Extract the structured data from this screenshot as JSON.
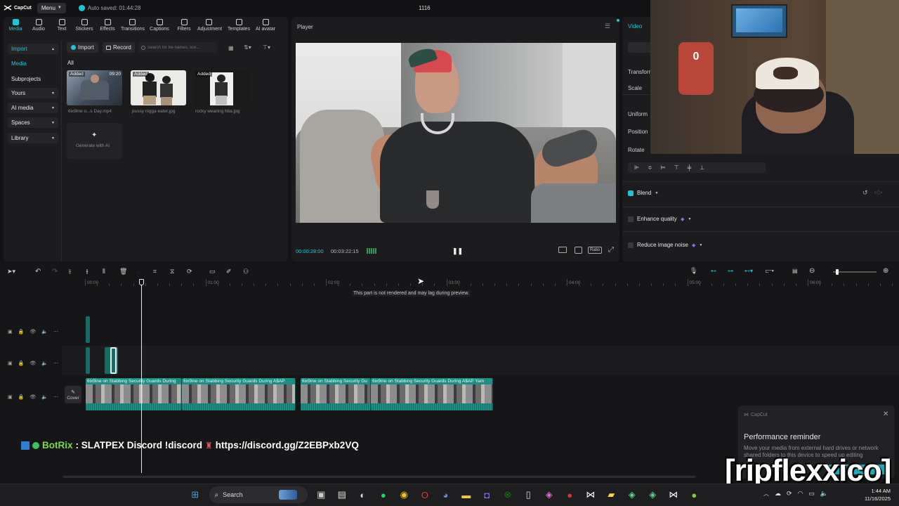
{
  "titlebar": {
    "logo": "CapCut",
    "menu": "Menu",
    "autosave": "Auto saved: 01:44:28",
    "project": "1116"
  },
  "toolbar": [
    {
      "label": "Media",
      "icon": "media-icon",
      "active": true
    },
    {
      "label": "Audio",
      "icon": "audio-icon"
    },
    {
      "label": "Text",
      "icon": "text-icon"
    },
    {
      "label": "Stickers",
      "icon": "stickers-icon"
    },
    {
      "label": "Effects",
      "icon": "effects-icon"
    },
    {
      "label": "Transitions",
      "icon": "transitions-icon"
    },
    {
      "label": "Captions",
      "icon": "captions-icon"
    },
    {
      "label": "Filters",
      "icon": "filters-icon"
    },
    {
      "label": "Adjustment",
      "icon": "adjustment-icon"
    },
    {
      "label": "Templates",
      "icon": "templates-icon"
    },
    {
      "label": "AI avatar",
      "icon": "ai-avatar-icon"
    }
  ],
  "sidebar": {
    "items": [
      "Import",
      "Media",
      "Subprojects",
      "Yours",
      "AI media",
      "Spaces",
      "Library"
    ]
  },
  "media": {
    "import_label": "Import",
    "record_label": "Record",
    "search_placeholder": "Search for file names, sce...",
    "filter_all": "All",
    "items": [
      {
        "name": "6ix9ine o...s Day.mp4",
        "badge": "Added",
        "duration": "09:20"
      },
      {
        "name": "pussy nigga eater.jpg",
        "badge": "Added"
      },
      {
        "name": "rocky wearing hba.jpg",
        "badge": "Added"
      }
    ],
    "generate_label": "Generate with AI"
  },
  "player": {
    "title": "Player",
    "current": "00:00:28:00",
    "total": "00:03:22:15",
    "ratio": "Ratio"
  },
  "details": {
    "tab": "Video",
    "transform": "Transform",
    "scale": "Scale",
    "uniform": "Uniform",
    "position": "Position",
    "rotate": "Rotate",
    "blend": "Blend",
    "enhance": "Enhance quality",
    "reduce_noise": "Reduce image noise"
  },
  "timeline": {
    "ruler": [
      "00:00",
      "01:00",
      "02:00",
      "03:00",
      "04:00",
      "05:00",
      "06:00"
    ],
    "lag_notice": "This part is not rendered and may lag during preview.",
    "cover_label": "Cover",
    "clip_titles": [
      "6ix9ine on Stabbing Security Guards During",
      "6ix9ine on Stabbing Security Guards During A$AP",
      "6ix9ine on Stabbing Security Gu",
      "6ix9ine on Stabbing Security Guards During A$AP Yam"
    ]
  },
  "chat": {
    "user": "BotRix",
    "message": ": SLATPEX Discord !discord",
    "link": "https://discord.gg/Z2EBPxb2VQ"
  },
  "notification": {
    "app": "CapCut",
    "title": "Performance reminder",
    "body": "Move your media from external hard drives or network shared folders to this device to speed up editing"
  },
  "watermark": "[ripflexxico]",
  "taskbar": {
    "search": "Search",
    "time": "1:44 AM",
    "date": "11/16/2025"
  },
  "colors": {
    "accent": "#1fc5d4",
    "clip": "#1b8f86",
    "bg": "#141416",
    "panel": "#1c1c1f"
  }
}
